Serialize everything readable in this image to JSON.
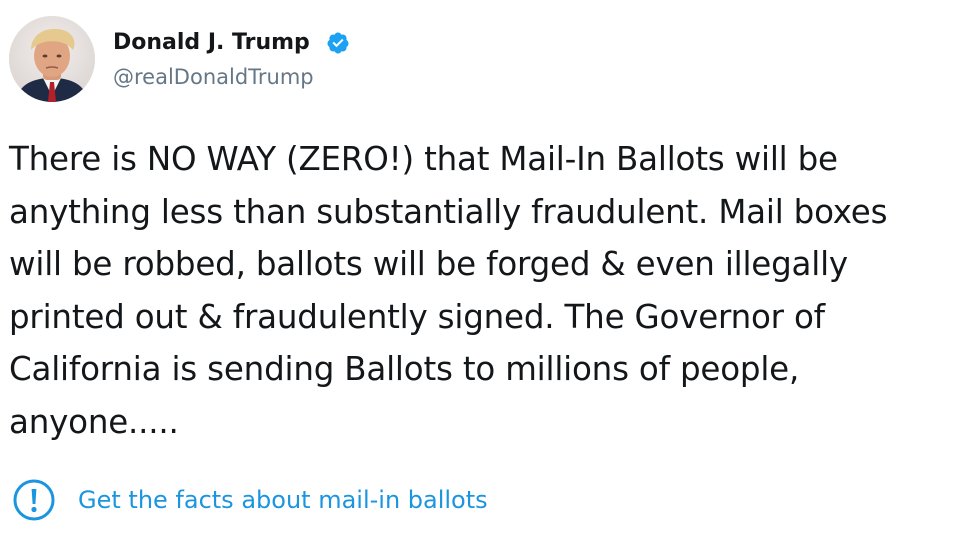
{
  "author": {
    "display_name": "Donald J. Trump",
    "handle": "@realDonaldTrump",
    "verified": true,
    "avatar_icon": "profile-photo",
    "verified_icon": "verified-badge-icon"
  },
  "tweet": {
    "text": "There is NO WAY (ZERO!) that Mail-In Ballots will be\nanything less than substantially fraudulent. Mail boxes\nwill be robbed, ballots will be forged & even illegally\nprinted out & fraudulently signed. The Governor of\nCalifornia is sending Ballots to millions of people,\nanyone....."
  },
  "fact_check": {
    "label": "Get the facts about mail-in ballots",
    "icon": "exclamation-circle-icon"
  },
  "colors": {
    "text": "#14171a",
    "secondary": "#657786",
    "link": "#1b95e0",
    "verified": "#1da1f2",
    "background": "#ffffff"
  }
}
